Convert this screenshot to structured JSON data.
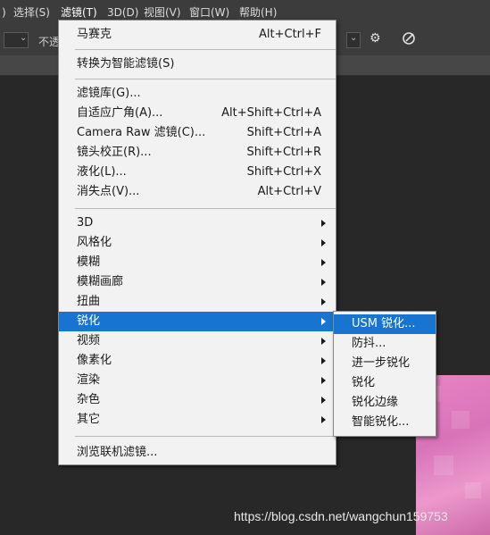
{
  "menubar": {
    "items": [
      {
        "label": ")"
      },
      {
        "label": "选择(S)"
      },
      {
        "label": "滤镜(T)"
      },
      {
        "label": "3D(D)"
      },
      {
        "label": "视图(V)"
      },
      {
        "label": "窗口(W)"
      },
      {
        "label": "帮助(H)"
      }
    ]
  },
  "optionsbar": {
    "partial_label": "不透",
    "settings_icon": "gear-icon",
    "pressure_icon": "pressure-icon"
  },
  "filter_menu": {
    "last_filter": {
      "label": "马赛克",
      "shortcut": "Alt+Ctrl+F"
    },
    "smart": {
      "label": "转换为智能滤镜(S)"
    },
    "group2": [
      {
        "label": "滤镜库(G)...",
        "shortcut": ""
      },
      {
        "label": "自适应广角(A)...",
        "shortcut": "Alt+Shift+Ctrl+A"
      },
      {
        "label": "Camera Raw 滤镜(C)...",
        "shortcut": "Shift+Ctrl+A"
      },
      {
        "label": "镜头校正(R)...",
        "shortcut": "Shift+Ctrl+R"
      },
      {
        "label": "液化(L)...",
        "shortcut": "Shift+Ctrl+X"
      },
      {
        "label": "消失点(V)...",
        "shortcut": "Alt+Ctrl+V"
      }
    ],
    "group3": [
      {
        "label": "3D"
      },
      {
        "label": "风格化"
      },
      {
        "label": "模糊"
      },
      {
        "label": "模糊画廊"
      },
      {
        "label": "扭曲"
      },
      {
        "label": "锐化"
      },
      {
        "label": "视频"
      },
      {
        "label": "像素化"
      },
      {
        "label": "渲染"
      },
      {
        "label": "杂色"
      },
      {
        "label": "其它"
      }
    ],
    "browse": {
      "label": "浏览联机滤镜..."
    }
  },
  "sharpen_submenu": {
    "items": [
      {
        "label": "USM 锐化..."
      },
      {
        "label": "防抖..."
      },
      {
        "label": "进一步锐化"
      },
      {
        "label": "锐化"
      },
      {
        "label": "锐化边缘"
      },
      {
        "label": "智能锐化..."
      }
    ]
  },
  "watermark": "https://blog.csdn.net/wangchun159753",
  "colors": {
    "highlight": "#1874d1",
    "menu_bg": "#f2f2f2",
    "app_bg": "#2b2b2b",
    "canvas_pink": "#e785c4"
  }
}
